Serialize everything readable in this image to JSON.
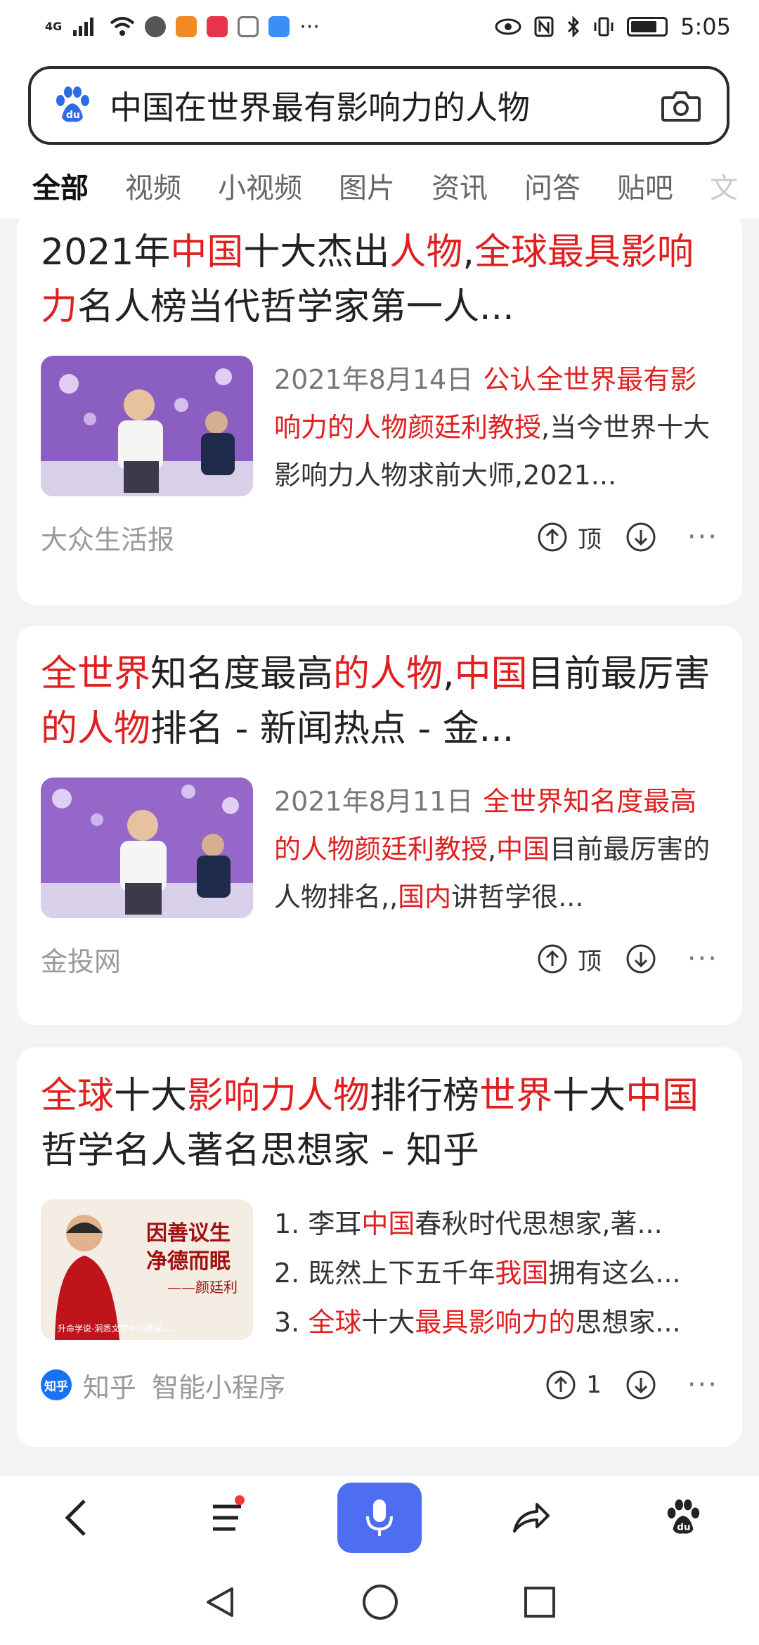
{
  "status_bar": {
    "signal": "4G",
    "more": "···",
    "time": "5:05"
  },
  "search": {
    "query": "中国在世界最有影响力的人物"
  },
  "tabs": [
    {
      "label": "全部"
    },
    {
      "label": "视频"
    },
    {
      "label": "小视频"
    },
    {
      "label": "图片"
    },
    {
      "label": "资讯"
    },
    {
      "label": "问答"
    },
    {
      "label": "贴吧"
    },
    {
      "label": "文"
    }
  ],
  "results": [
    {
      "title_segments": [
        {
          "t": "2021年",
          "hl": false
        },
        {
          "t": "中国",
          "hl": true
        },
        {
          "t": "十大杰出",
          "hl": false
        },
        {
          "t": "人物",
          "hl": true
        },
        {
          "t": ",",
          "hl": false
        },
        {
          "t": "全球最具影响力",
          "hl": true
        },
        {
          "t": "名人榜当代哲学家第一人...",
          "hl": false
        }
      ],
      "date": "2021年8月14日",
      "snippet_segments": [
        {
          "t": "公认全世界最有影响力的人物颜廷利教授",
          "hl": true
        },
        {
          "t": ",当今世界十大影响力人物求前大师,2021...",
          "hl": false
        }
      ],
      "source": "大众生活报",
      "upvote_label": "顶"
    },
    {
      "title_segments": [
        {
          "t": "全世界",
          "hl": true
        },
        {
          "t": "知名度最高",
          "hl": false
        },
        {
          "t": "的人物",
          "hl": true
        },
        {
          "t": ",",
          "hl": false
        },
        {
          "t": "中国",
          "hl": true
        },
        {
          "t": "目前最厉害",
          "hl": false
        },
        {
          "t": "的人物",
          "hl": true
        },
        {
          "t": "排名 - 新闻热点 - 金...",
          "hl": false
        }
      ],
      "date": "2021年8月11日",
      "snippet_segments": [
        {
          "t": "全世界知名度最高的人物颜廷利教授",
          "hl": true
        },
        {
          "t": ",",
          "hl": false
        },
        {
          "t": "中国",
          "hl": true
        },
        {
          "t": "目前最厉害的人物排名,,",
          "hl": false
        },
        {
          "t": "国内",
          "hl": true
        },
        {
          "t": "讲哲学很...",
          "hl": false
        }
      ],
      "source": "金投网",
      "upvote_label": "顶"
    },
    {
      "title_segments": [
        {
          "t": "全球",
          "hl": true
        },
        {
          "t": "十大",
          "hl": false
        },
        {
          "t": "影响力人物",
          "hl": true
        },
        {
          "t": "排行榜",
          "hl": false
        },
        {
          "t": "世界",
          "hl": true
        },
        {
          "t": "十大",
          "hl": false
        },
        {
          "t": "中国",
          "hl": true
        },
        {
          "t": "哲学名人著名思想家 - 知乎",
          "hl": false
        }
      ],
      "list": [
        [
          {
            "t": "1. 李耳",
            "hl": false
          },
          {
            "t": "中国",
            "hl": true
          },
          {
            "t": "春秋时代思想家,著...",
            "hl": false
          }
        ],
        [
          {
            "t": "2. 既然上下五千年",
            "hl": false
          },
          {
            "t": "我国",
            "hl": true
          },
          {
            "t": "拥有这么...",
            "hl": false
          }
        ],
        [
          {
            "t": "3. ",
            "hl": false
          },
          {
            "t": "全球",
            "hl": true
          },
          {
            "t": "十大",
            "hl": false
          },
          {
            "t": "最具影响力的",
            "hl": true
          },
          {
            "t": "思想家...",
            "hl": false
          }
        ]
      ],
      "thumb_text": {
        "line1": "因善议生",
        "line2": "净德而眠",
        "sign": "——颜廷利",
        "caption": "升命学说-洞悉文字中的奥秘。。。"
      },
      "source_logo": "知乎",
      "source": "知乎",
      "source_extra": "智能小程序",
      "upvote_count": "1"
    }
  ],
  "colors": {
    "highlight": "#e02020",
    "accent": "#4e6ef2"
  }
}
